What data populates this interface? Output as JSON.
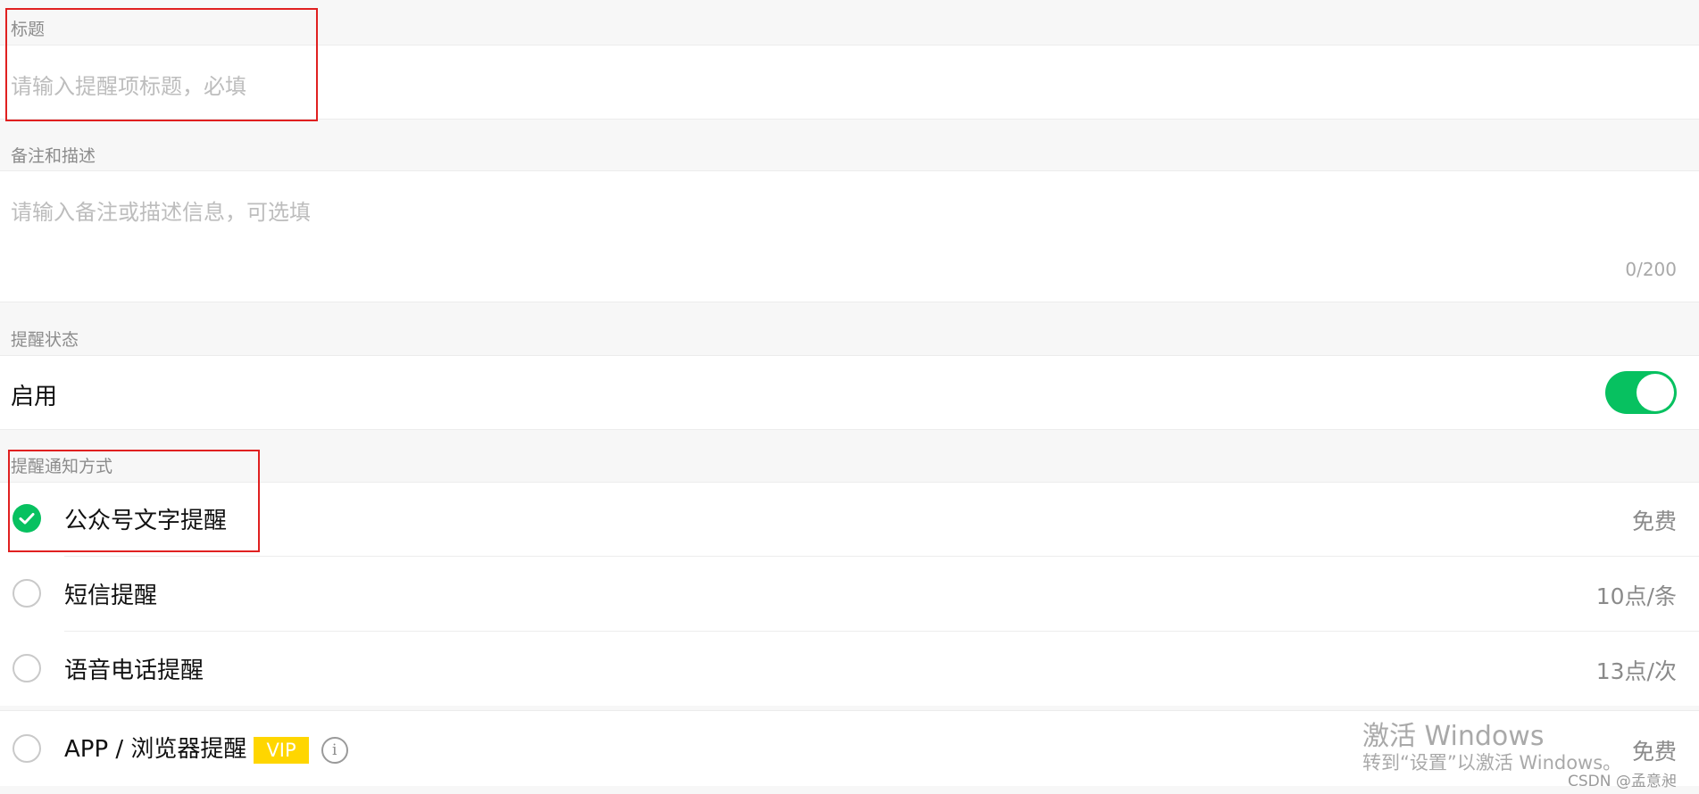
{
  "title_section": {
    "label": "标题",
    "placeholder": "请输入提醒项标题，必填"
  },
  "notes_section": {
    "label": "备注和描述",
    "placeholder": "请输入备注或描述信息，可选填",
    "counter": "0/200"
  },
  "status_section": {
    "label": "提醒状态",
    "toggle_label": "启用",
    "enabled": true
  },
  "notify_section": {
    "label": "提醒通知方式",
    "options": [
      {
        "label": "公众号文字提醒",
        "price": "免费",
        "checked": true
      },
      {
        "label": "短信提醒",
        "price": "10点/条",
        "checked": false
      },
      {
        "label": "语音电话提醒",
        "price": "13点/次",
        "checked": false
      },
      {
        "label": "APP / 浏览器提醒",
        "badge": "VIP",
        "info_icon": "i",
        "price": "免费",
        "checked": false
      }
    ]
  },
  "watermark": {
    "line1": "激活 Windows",
    "line2": "转到“设置”以激活 Windows。"
  },
  "credit": "CSDN @孟意昶",
  "colors": {
    "accent": "#07c160",
    "highlight_box": "#e02020",
    "vip_badge": "#ffd600"
  }
}
